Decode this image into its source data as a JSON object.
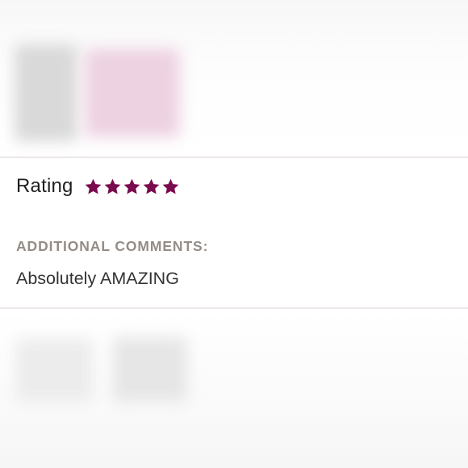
{
  "review": {
    "rating_label": "Rating",
    "rating_value": 5,
    "rating_max": 5,
    "star_color": "#7a0b4f",
    "comments_heading": "ADDITIONAL COMMENTS:",
    "comments_text": "Absolutely AMAZING"
  },
  "icons": {
    "star": "star-icon"
  }
}
